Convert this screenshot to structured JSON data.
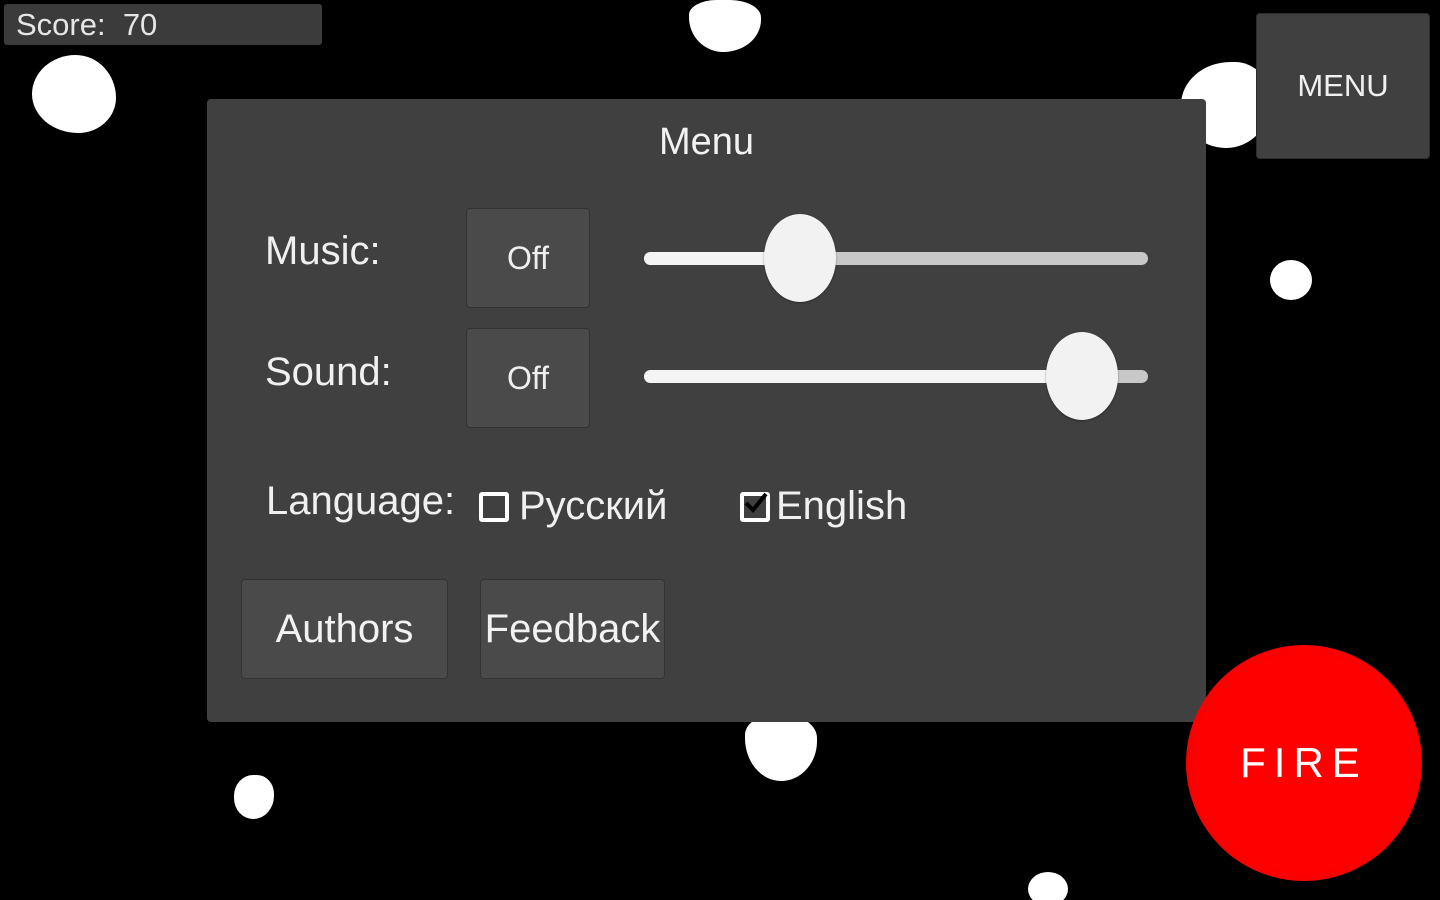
{
  "colors": {
    "background": "#000000",
    "panel": "#404040",
    "button": "#4a4a4a",
    "text": "#f0f0f0",
    "fire": "#ff0000",
    "asteroid": "#ffffff"
  },
  "hud": {
    "score_text": "Score:  70"
  },
  "menu_button": {
    "label": "MENU"
  },
  "menu": {
    "title": "Menu",
    "music": {
      "label": "Music:",
      "toggle_label": "Off",
      "volume": 0.31
    },
    "sound": {
      "label": "Sound:",
      "toggle_label": "Off",
      "volume": 0.87
    },
    "language": {
      "label": "Language:",
      "options": [
        {
          "label": "Русский",
          "checked": false
        },
        {
          "label": "English",
          "checked": true
        }
      ]
    },
    "authors_label": "Authors",
    "feedback_label": "Feedback"
  },
  "fire_button": {
    "label": "FIRE"
  }
}
